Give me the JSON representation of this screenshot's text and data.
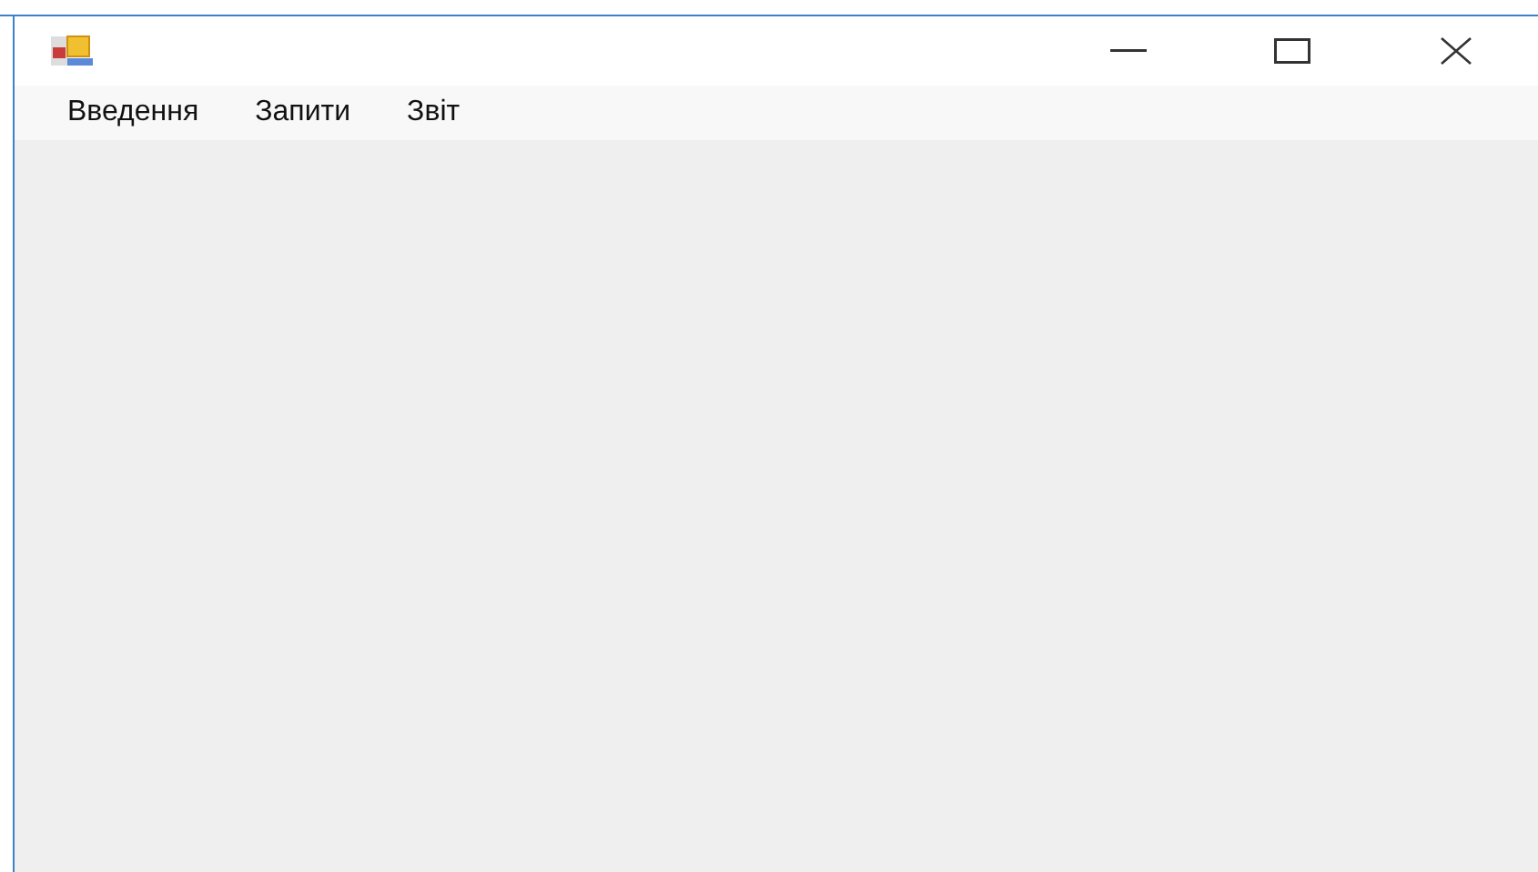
{
  "menu": {
    "items": [
      "Введення",
      "Запити",
      "Звіт"
    ]
  }
}
